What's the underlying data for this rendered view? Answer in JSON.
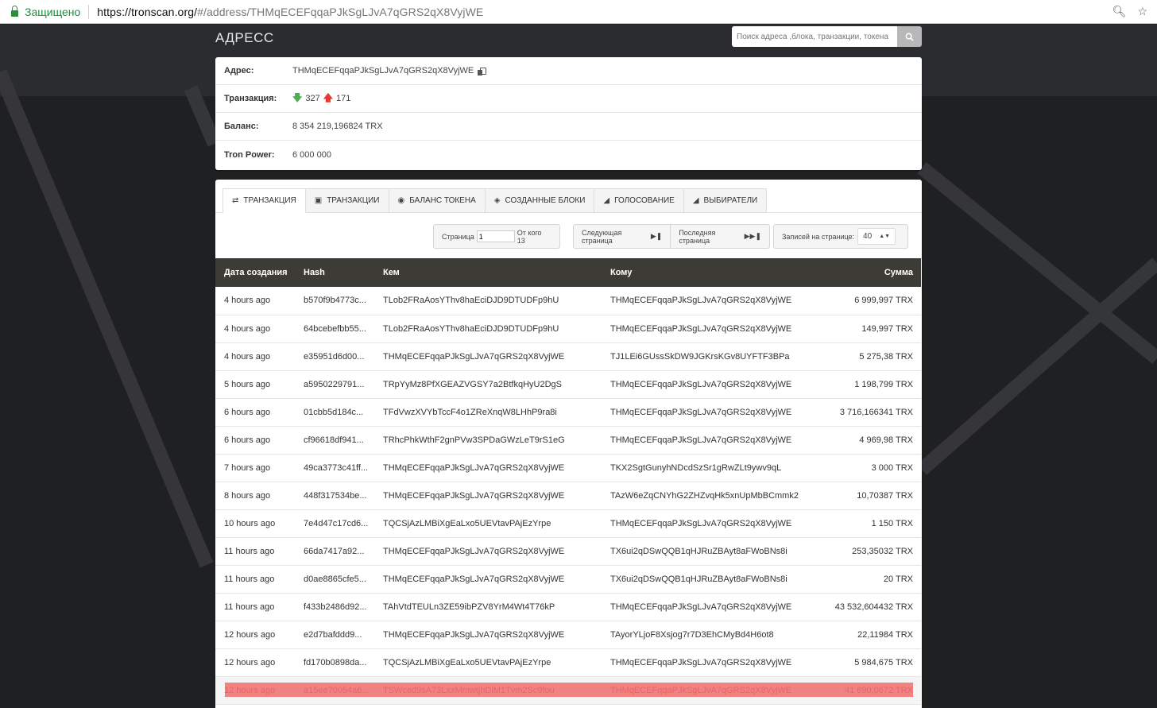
{
  "browser": {
    "secure_label": "Защищено",
    "url_host": "https://tronscan.org/",
    "url_rest": "#/address/THMqECEFqqaPJkSgLJvA7qGRS2qX8VyjWE"
  },
  "header": {
    "title": "АДРЕСС",
    "search_placeholder": "Поиск адреса ,блока, транзакции, токена"
  },
  "info": {
    "address_label": "Адрес:",
    "address_value": "THMqECEFqqaPJkSgLJvA7qGRS2qX8VyjWE",
    "tx_label": "Транзакция:",
    "tx_in": "327",
    "tx_out": "171",
    "balance_label": "Баланс:",
    "balance_value": "8 354 219,196824 TRX",
    "power_label": "Tron Power:",
    "power_value": "6 000 000"
  },
  "tabs": [
    {
      "label": "ТРАНЗАКЦИЯ",
      "icon": "exchange-icon"
    },
    {
      "label": "ТРАНЗАКЦИИ",
      "icon": "money-icon"
    },
    {
      "label": "БАЛАНС ТОКЕНА",
      "icon": "android-icon"
    },
    {
      "label": "СОЗДАННЫЕ БЛОКИ",
      "icon": "cube-icon"
    },
    {
      "label": "ГОЛОСОВАНИЕ",
      "icon": "bullhorn-icon"
    },
    {
      "label": "ВЫБИРАТЕЛИ",
      "icon": "bullhorn-icon"
    }
  ],
  "pager": {
    "page_label": "Страница",
    "page_value": "1",
    "of_label": "От кого 13",
    "next_label": "Следующая страница",
    "last_label": "Последняя страница",
    "per_page_label": "Записей на странице:",
    "per_page_value": "40"
  },
  "table": {
    "headers": [
      "Дата создания",
      "Hash",
      "Кем",
      "Кому",
      "Сумма"
    ],
    "rows": [
      [
        "4 hours ago",
        "b570f9b4773c...",
        "TLob2FRaAosYThv8haEciDJD9DTUDFp9hU",
        "THMqECEFqqaPJkSgLJvA7qGRS2qX8VyjWE",
        "6 999,997 TRX"
      ],
      [
        "4 hours ago",
        "64bcebefbb55...",
        "TLob2FRaAosYThv8haEciDJD9DTUDFp9hU",
        "THMqECEFqqaPJkSgLJvA7qGRS2qX8VyjWE",
        "149,997 TRX"
      ],
      [
        "4 hours ago",
        "e35951d6d00...",
        "THMqECEFqqaPJkSgLJvA7qGRS2qX8VyjWE",
        "TJ1LEi6GUssSkDW9JGKrsKGv8UYFTF3BPa",
        "5 275,38 TRX"
      ],
      [
        "5 hours ago",
        "a5950229791...",
        "TRpYyMz8PfXGEAZVGSY7a2BtfkqHyU2DgS",
        "THMqECEFqqaPJkSgLJvA7qGRS2qX8VyjWE",
        "1 198,799 TRX"
      ],
      [
        "6 hours ago",
        "01cbb5d184c...",
        "TFdVwzXVYbTccF4o1ZReXnqW8LHhP9ra8i",
        "THMqECEFqqaPJkSgLJvA7qGRS2qX8VyjWE",
        "3 716,166341 TRX"
      ],
      [
        "6 hours ago",
        "cf96618df941...",
        "TRhcPhkWthF2gnPVw3SPDaGWzLeT9rS1eG",
        "THMqECEFqqaPJkSgLJvA7qGRS2qX8VyjWE",
        "4 969,98 TRX"
      ],
      [
        "7 hours ago",
        "49ca3773c41ff...",
        "THMqECEFqqaPJkSgLJvA7qGRS2qX8VyjWE",
        "TKX2SgtGunyhNDcdSzSr1gRwZLt9ywv9qL",
        "3 000 TRX"
      ],
      [
        "8 hours ago",
        "448f317534be...",
        "THMqECEFqqaPJkSgLJvA7qGRS2qX8VyjWE",
        "TAzW6eZqCNYhG2ZHZvqHk5xnUpMbBCmmk2",
        "10,70387 TRX"
      ],
      [
        "10 hours ago",
        "7e4d47c17cd6...",
        "TQCSjAzLMBiXgEaLxo5UEVtavPAjEzYrpe",
        "THMqECEFqqaPJkSgLJvA7qGRS2qX8VyjWE",
        "1 150 TRX"
      ],
      [
        "11 hours ago",
        "66da7417a92...",
        "THMqECEFqqaPJkSgLJvA7qGRS2qX8VyjWE",
        "TX6ui2qDSwQQB1qHJRuZBAyt8aFWoBNs8i",
        "253,35032 TRX"
      ],
      [
        "11 hours ago",
        "d0ae8865cfe5...",
        "THMqECEFqqaPJkSgLJvA7qGRS2qX8VyjWE",
        "TX6ui2qDSwQQB1qHJRuZBAyt8aFWoBNs8i",
        "20 TRX"
      ],
      [
        "11 hours ago",
        "f433b2486d92...",
        "TAhVtdTEULn3ZE59ibPZV8YrM4Wt4T76kP",
        "THMqECEFqqaPJkSgLJvA7qGRS2qX8VyjWE",
        "43 532,604432 TRX"
      ],
      [
        "12 hours ago",
        "e2d7bafddd9...",
        "THMqECEFqqaPJkSgLJvA7qGRS2qX8VyjWE",
        "TAyorYLjoF8Xsjog7r7D3EhCMyBd4H6ot8",
        "22,11984 TRX"
      ],
      [
        "12 hours ago",
        "fd170b0898da...",
        "TQCSjAzLMBiXgEaLxo5UEVtavPAjEzYrpe",
        "THMqECEFqqaPJkSgLJvA7qGRS2qX8VyjWE",
        "5 984,675 TRX"
      ],
      [
        "12 hours ago",
        "a15ee70054a6...",
        "TSWced9sA73LxxMmwtjhDiM1Tvm2Sc9fou",
        "THMqECEFqqaPJkSgLJvA7qGRS2qX8VyjWE",
        "41 690,0672 TRX"
      ]
    ]
  },
  "colors": {
    "table_header": "#3c3b36",
    "highlight": "#ee6d6d",
    "arrow_in": "#4caf50",
    "arrow_out": "#e53935"
  }
}
